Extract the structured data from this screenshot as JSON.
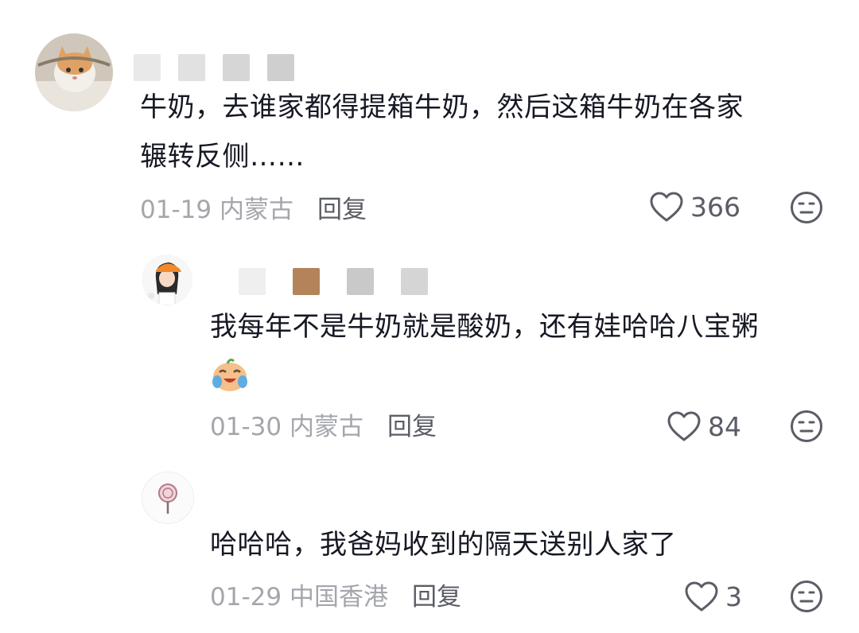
{
  "comments": [
    {
      "text_line1": "牛奶，去谁家都得提箱牛奶，然后这箱牛奶在各家",
      "text_line2": "辗转反侧……",
      "date": "01-19",
      "location": "内蒙古",
      "reply_label": "回复",
      "likes": "366"
    },
    {
      "text_line1": "我每年不是牛奶就是酸奶，还有娃哈哈八宝粥",
      "date": "01-30",
      "location": "内蒙古",
      "reply_label": "回复",
      "likes": "84"
    },
    {
      "text_line1": "哈哈哈，我爸妈收到的隔天送别人家了",
      "date": "01-29",
      "location": "中国香港",
      "reply_label": "回复",
      "likes": "3"
    }
  ],
  "icons": {
    "like": "heart-outline-icon",
    "dislike": "neutral-face-icon",
    "emoji": "crying-laughing-emoji"
  },
  "colors": {
    "text": "#161823",
    "meta": "#a4a6ac",
    "action": "#5b5d66"
  }
}
